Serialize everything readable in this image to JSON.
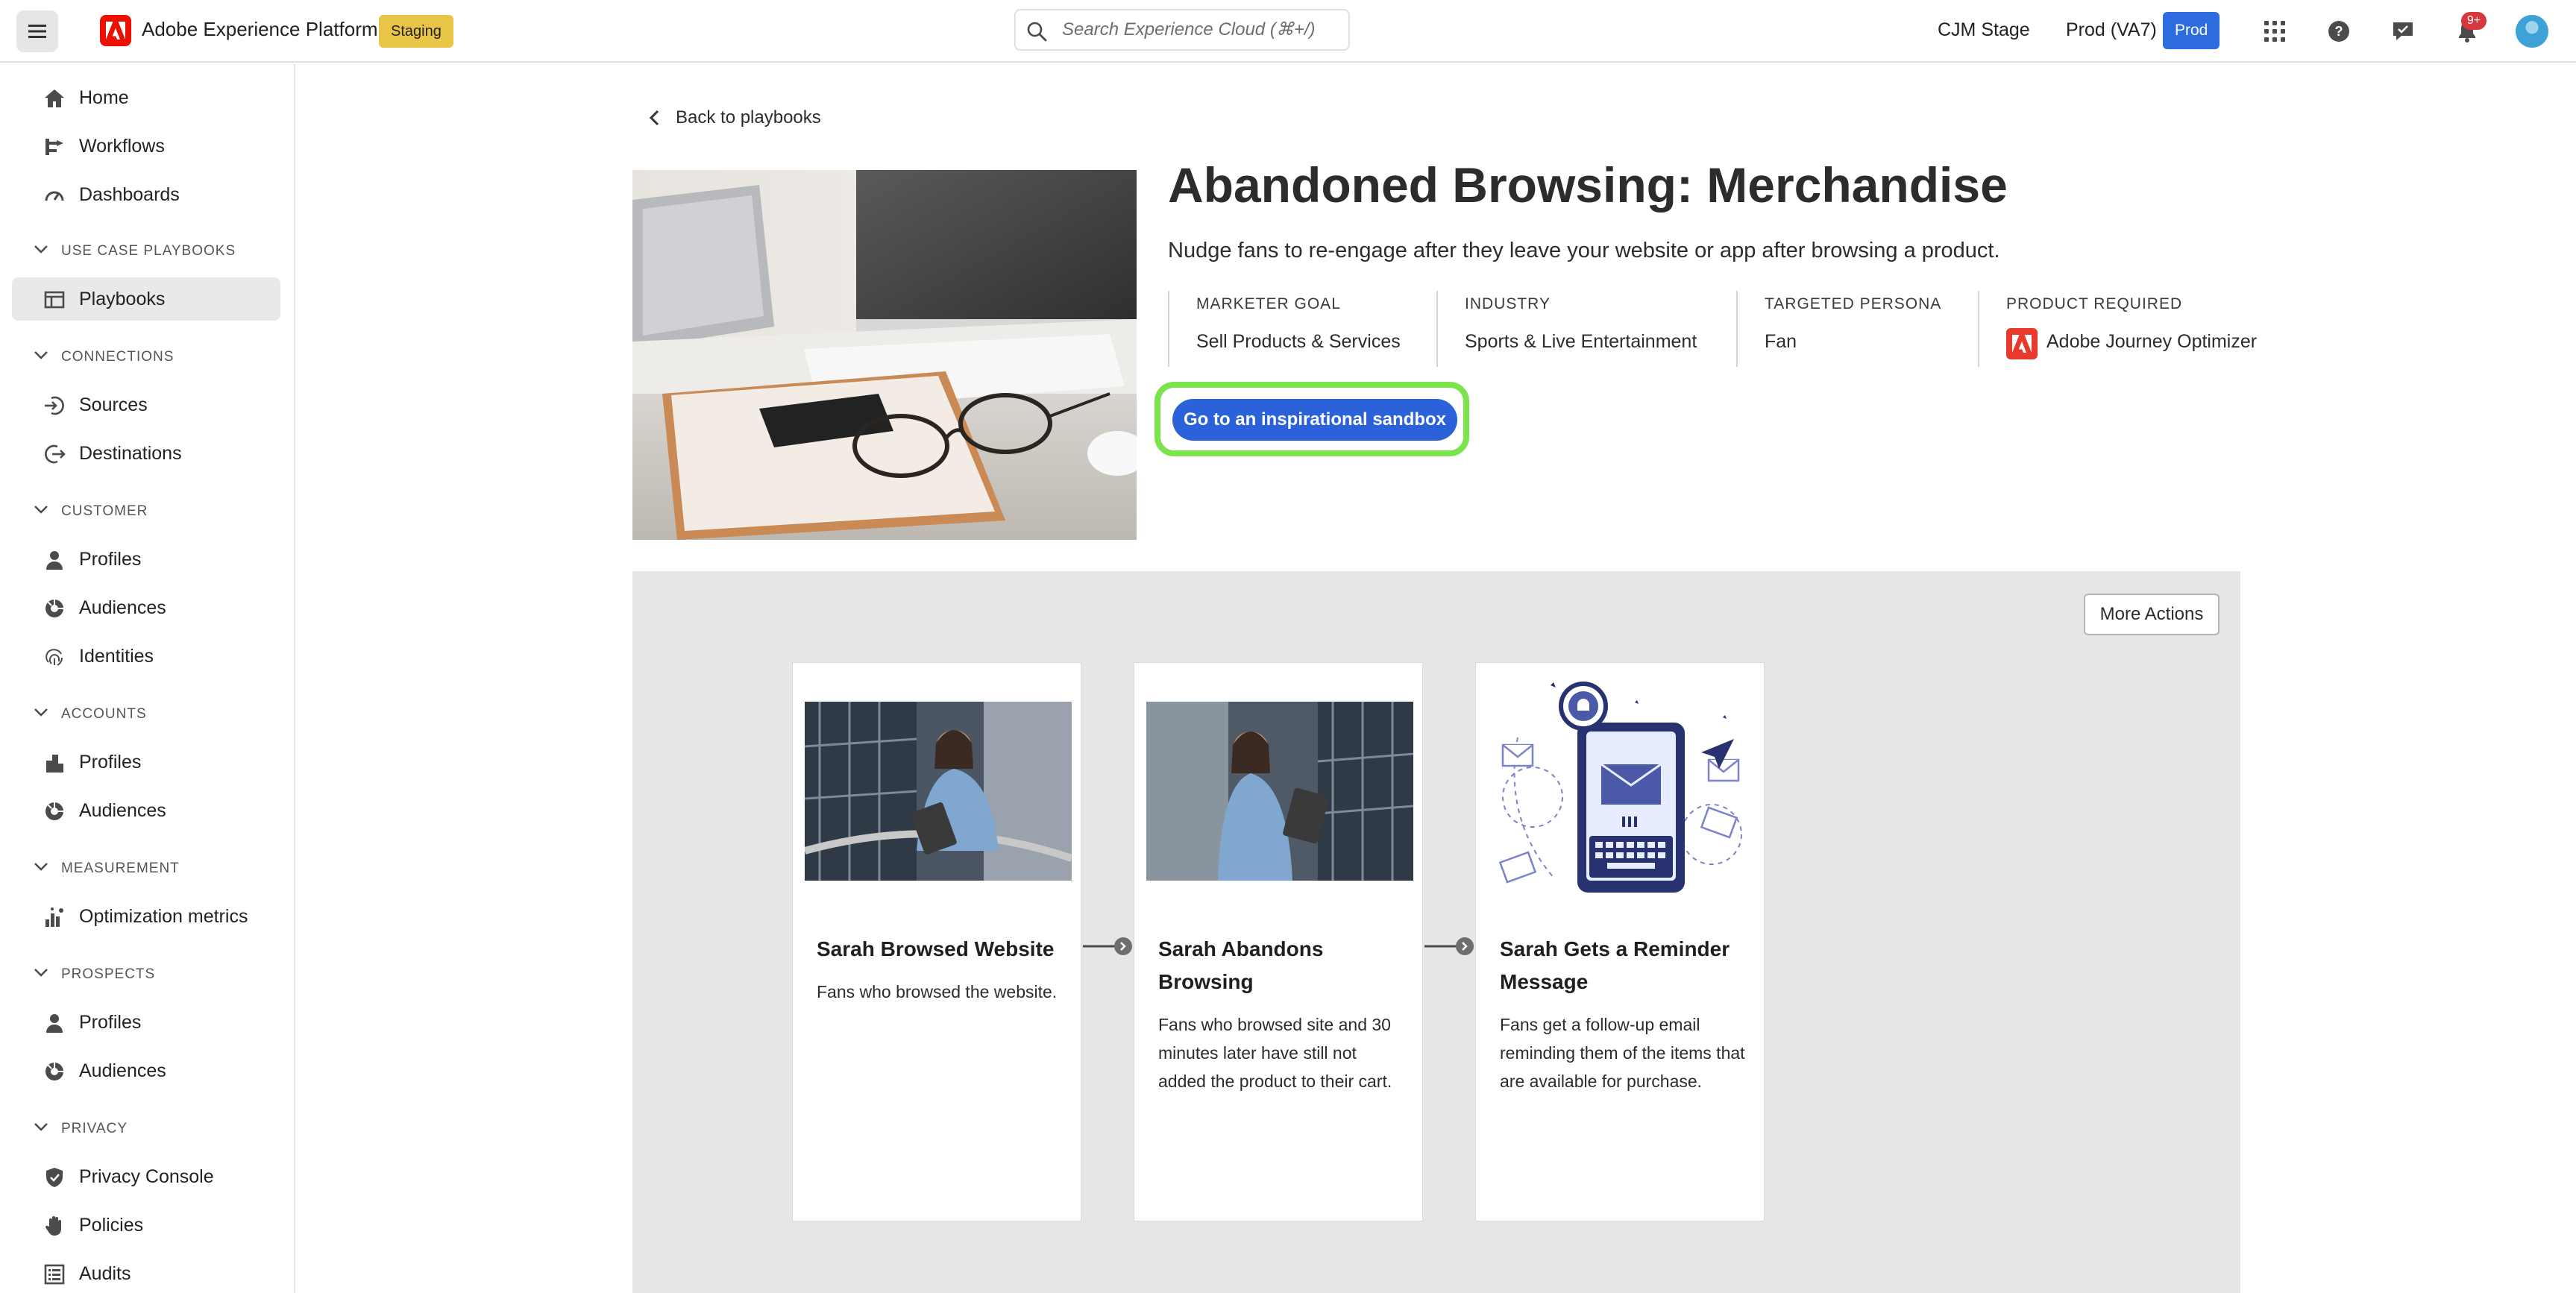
{
  "header": {
    "app_title": "Adobe Experience Platform",
    "env_badge": "Staging",
    "search_placeholder": "Search Experience Cloud (⌘+/)",
    "org_name": "CJM Stage",
    "sandbox_name": "Prod (VA7)",
    "sandbox_badge": "Prod",
    "notification_count": "9+",
    "brand_color": "#eb1000",
    "accent_color": "#2c6cdf"
  },
  "sidebar": {
    "items": [
      {
        "label": "Home",
        "icon": "home-icon"
      },
      {
        "label": "Workflows",
        "icon": "workflows-icon"
      },
      {
        "label": "Dashboards",
        "icon": "dashboard-icon"
      }
    ],
    "sections": [
      {
        "title": "USE CASE PLAYBOOKS",
        "items": [
          {
            "label": "Playbooks",
            "icon": "playbooks-icon",
            "selected": true
          }
        ]
      },
      {
        "title": "CONNECTIONS",
        "items": [
          {
            "label": "Sources",
            "icon": "sources-icon"
          },
          {
            "label": "Destinations",
            "icon": "destinations-icon"
          }
        ]
      },
      {
        "title": "CUSTOMER",
        "items": [
          {
            "label": "Profiles",
            "icon": "user-icon"
          },
          {
            "label": "Audiences",
            "icon": "audiences-icon"
          },
          {
            "label": "Identities",
            "icon": "fingerprint-icon"
          }
        ]
      },
      {
        "title": "ACCOUNTS",
        "items": [
          {
            "label": "Profiles",
            "icon": "building-icon"
          },
          {
            "label": "Audiences",
            "icon": "audiences-icon"
          }
        ]
      },
      {
        "title": "MEASUREMENT",
        "items": [
          {
            "label": "Optimization metrics",
            "icon": "metrics-icon"
          }
        ]
      },
      {
        "title": "PROSPECTS",
        "items": [
          {
            "label": "Profiles",
            "icon": "user-icon"
          },
          {
            "label": "Audiences",
            "icon": "audiences-icon"
          }
        ]
      },
      {
        "title": "PRIVACY",
        "items": [
          {
            "label": "Privacy Console",
            "icon": "shield-icon"
          },
          {
            "label": "Policies",
            "icon": "hand-icon"
          },
          {
            "label": "Audits",
            "icon": "audits-icon"
          }
        ]
      }
    ]
  },
  "main": {
    "back_label": "Back to playbooks",
    "title": "Abandoned Browsing: Merchandise",
    "description": "Nudge fans to re-engage after they leave your website or app after browsing a product.",
    "meta": [
      {
        "label": "MARKETER GOAL",
        "value": "Sell Products & Services"
      },
      {
        "label": "INDUSTRY",
        "value": "Sports & Live Entertainment"
      },
      {
        "label": "TARGETED PERSONA",
        "value": "Fan"
      },
      {
        "label": "PRODUCT REQUIRED",
        "value": "Adobe Journey Optimizer"
      }
    ],
    "cta_label": "Go to an inspirational sandbox",
    "cta_highlight_color": "#7be34b",
    "more_actions_label": "More Actions",
    "steps": [
      {
        "title": "Sarah Browsed Website",
        "description": "Fans who browsed the website."
      },
      {
        "title": "Sarah Abandons Browsing",
        "description": "Fans who browsed site and 30 minutes later have still not added the product to their cart."
      },
      {
        "title": "Sarah Gets a Reminder Message",
        "description": "Fans get a follow-up email reminding them of the items that are available for purchase."
      }
    ]
  }
}
